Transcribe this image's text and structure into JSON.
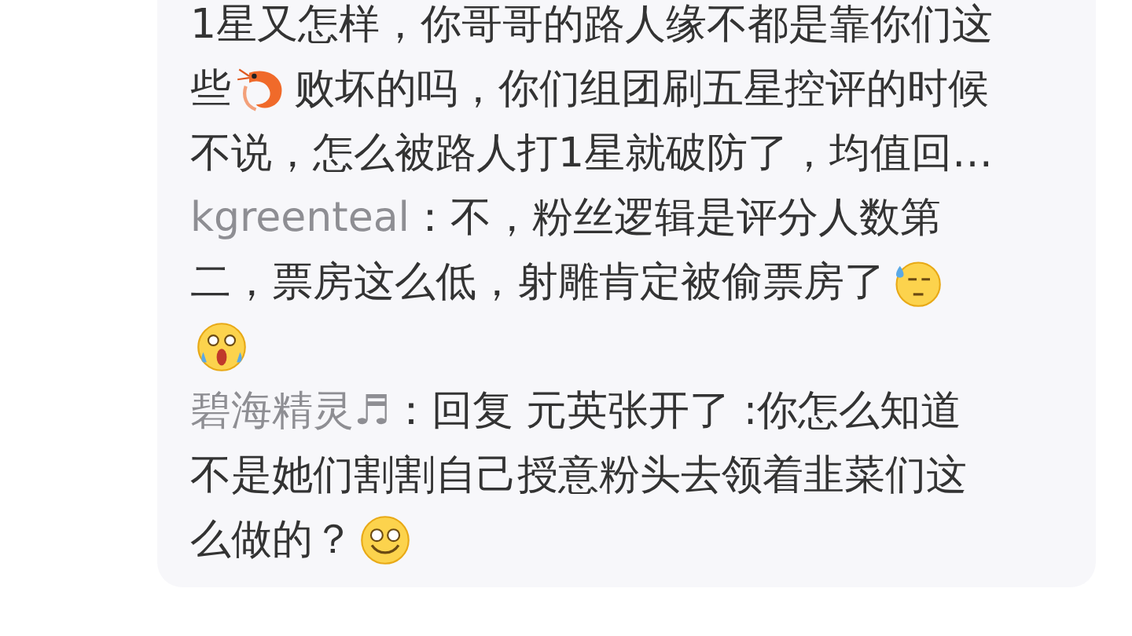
{
  "comments": [
    {
      "lines": [
        [
          {
            "kind": "text",
            "text": "1星又怎样，你哥哥的路人缘不都是靠你们这"
          }
        ],
        [
          {
            "kind": "text",
            "text": "些"
          },
          {
            "kind": "shrimp"
          },
          {
            "kind": "text",
            "text": "败坏的吗，你们组团刷五星控评的时候"
          }
        ],
        [
          {
            "kind": "text",
            "text": "不说，怎么被路人打1星就破防了，均值回…"
          }
        ]
      ]
    },
    {
      "author": "kgreenteal",
      "lines": [
        [
          {
            "kind": "text",
            "text": "：不，粉丝逻辑是评分人数第"
          }
        ],
        [
          {
            "kind": "text",
            "text": "二，票房这么低，射雕肯定被偷票房了"
          },
          {
            "kind": "sweat"
          }
        ],
        [
          {
            "kind": "scream"
          }
        ]
      ]
    },
    {
      "author": "碧海精灵♬",
      "lines": [
        [
          {
            "kind": "text",
            "text": "：回复 元英张开了 :你怎么知道"
          }
        ],
        [
          {
            "kind": "text",
            "text": "不是她们割割自己授意粉头去领着韭菜们这"
          }
        ],
        [
          {
            "kind": "text",
            "text": "么做的？"
          },
          {
            "kind": "smile"
          }
        ]
      ]
    }
  ]
}
